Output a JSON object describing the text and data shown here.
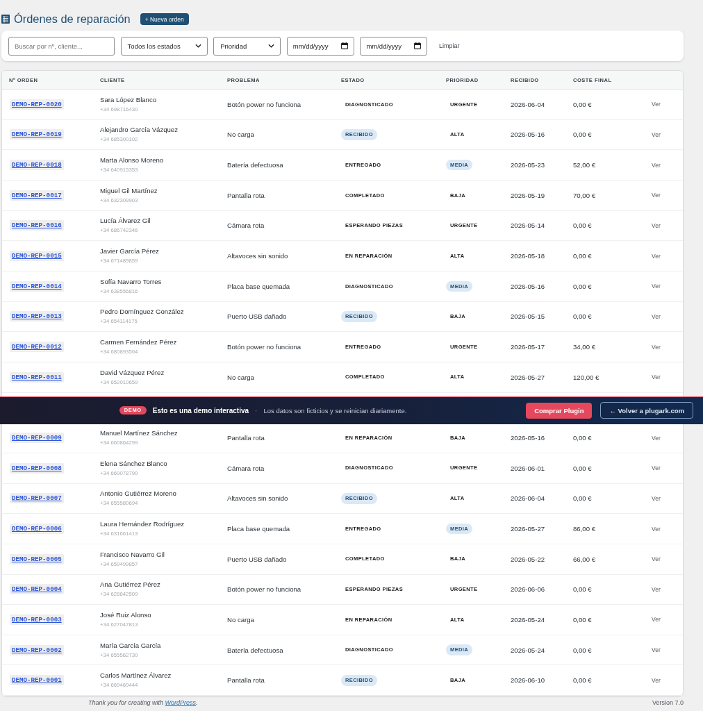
{
  "header": {
    "title": "Órdenes de reparación",
    "new_button": "+ Nueva orden"
  },
  "filters": {
    "search": {
      "placeholder": "Buscar por nº, cliente..."
    },
    "status_select": {
      "value": "Todos los estados"
    },
    "priority_select": {
      "value": "Prioridad"
    },
    "date_from": {
      "placeholder": "mm/dd/yyyy"
    },
    "date_to": {
      "placeholder": "mm/dd/yyyy"
    },
    "clear_button": "Limpiar"
  },
  "table": {
    "columns": [
      "Nº ORDEN",
      "CLIENTE",
      "PROBLEMA",
      "ESTADO",
      "PRIORIDAD",
      "RECIBIDO",
      "COSTE FINAL"
    ],
    "rows_above_banner": [
      {
        "order": "DEMO-REP-0020",
        "client": "Sara López Blanco",
        "phone": "+34 698716430",
        "problem": "Botón power no funciona",
        "status": {
          "label": "DIAGNOSTICADO",
          "kind": "plain"
        },
        "priority": {
          "label": "URGENTE",
          "kind": "plain"
        },
        "received": "2026-06-04",
        "cost": "0,00 €",
        "action": "Ver"
      },
      {
        "order": "DEMO-REP-0019",
        "client": "Alejandro García Vázquez",
        "phone": "+34 685300102",
        "problem": "No carga",
        "status": {
          "label": "RECIBIDO",
          "kind": "pill"
        },
        "priority": {
          "label": "ALTA",
          "kind": "plain"
        },
        "received": "2026-05-16",
        "cost": "0,00 €",
        "action": "Ver"
      },
      {
        "order": "DEMO-REP-0018",
        "client": "Marta Alonso Moreno",
        "phone": "+34 640915353",
        "problem": "Batería defectuosa",
        "status": {
          "label": "ENTREGADO",
          "kind": "plain"
        },
        "priority": {
          "label": "MEDIA",
          "kind": "pill"
        },
        "received": "2026-05-23",
        "cost": "52,00 €",
        "action": "Ver"
      },
      {
        "order": "DEMO-REP-0017",
        "client": "Miguel Gil Martínez",
        "phone": "+34 632309903",
        "problem": "Pantalla rota",
        "status": {
          "label": "COMPLETADO",
          "kind": "plain"
        },
        "priority": {
          "label": "BAJA",
          "kind": "plain"
        },
        "received": "2026-05-19",
        "cost": "70,00 €",
        "action": "Ver"
      },
      {
        "order": "DEMO-REP-0016",
        "client": "Lucía Álvarez Gil",
        "phone": "+34 686742346",
        "problem": "Cámara rota",
        "status": {
          "label": "ESPERANDO PIEZAS",
          "kind": "plain"
        },
        "priority": {
          "label": "URGENTE",
          "kind": "plain"
        },
        "received": "2026-05-14",
        "cost": "0,00 €",
        "action": "Ver"
      },
      {
        "order": "DEMO-REP-0015",
        "client": "Javier García Pérez",
        "phone": "+34 671489859",
        "problem": "Altavoces sin sonido",
        "status": {
          "label": "EN REPARACIÓN",
          "kind": "plain"
        },
        "priority": {
          "label": "ALTA",
          "kind": "plain"
        },
        "received": "2026-05-18",
        "cost": "0,00 €",
        "action": "Ver"
      },
      {
        "order": "DEMO-REP-0014",
        "client": "Sofía Navarro Torres",
        "phone": "+34 638556816",
        "problem": "Placa base quemada",
        "status": {
          "label": "DIAGNOSTICADO",
          "kind": "plain"
        },
        "priority": {
          "label": "MEDIA",
          "kind": "pill"
        },
        "received": "2026-05-16",
        "cost": "0,00 €",
        "action": "Ver"
      },
      {
        "order": "DEMO-REP-0013",
        "client": "Pedro Domínguez González",
        "phone": "+34 654114175",
        "problem": "Puerto USB dañado",
        "status": {
          "label": "RECIBIDO",
          "kind": "pill"
        },
        "priority": {
          "label": "BAJA",
          "kind": "plain"
        },
        "received": "2026-05-15",
        "cost": "0,00 €",
        "action": "Ver"
      },
      {
        "order": "DEMO-REP-0012",
        "client": "Carmen Fernández Pérez",
        "phone": "+34 680893504",
        "problem": "Botón power no funciona",
        "status": {
          "label": "ENTREGADO",
          "kind": "plain"
        },
        "priority": {
          "label": "URGENTE",
          "kind": "plain"
        },
        "received": "2026-05-17",
        "cost": "34,00 €",
        "action": "Ver"
      },
      {
        "order": "DEMO-REP-0011",
        "client": "David Vázquez Pérez",
        "phone": "+34 652010659",
        "problem": "No carga",
        "status": {
          "label": "COMPLETADO",
          "kind": "plain"
        },
        "priority": {
          "label": "ALTA",
          "kind": "plain"
        },
        "received": "2026-05-27",
        "cost": "120,00 €",
        "action": "Ver"
      }
    ],
    "rows_below_banner": [
      {
        "order": "DEMO-REP-0009",
        "client": "Manuel Martínez Sánchez",
        "phone": "+34 660864299",
        "problem": "Pantalla rota",
        "status": {
          "label": "EN REPARACIÓN",
          "kind": "plain"
        },
        "priority": {
          "label": "BAJA",
          "kind": "plain"
        },
        "received": "2026-05-16",
        "cost": "0,00 €",
        "action": "Ver"
      },
      {
        "order": "DEMO-REP-0008",
        "client": "Elena Sánchez Blanco",
        "phone": "+34 669078790",
        "problem": "Cámara rota",
        "status": {
          "label": "DIAGNOSTICADO",
          "kind": "plain"
        },
        "priority": {
          "label": "URGENTE",
          "kind": "plain"
        },
        "received": "2026-06-01",
        "cost": "0,00 €",
        "action": "Ver"
      },
      {
        "order": "DEMO-REP-0007",
        "client": "Antonio Gutiérrez Moreno",
        "phone": "+34 655580694",
        "problem": "Altavoces sin sonido",
        "status": {
          "label": "RECIBIDO",
          "kind": "pill"
        },
        "priority": {
          "label": "ALTA",
          "kind": "plain"
        },
        "received": "2026-06-04",
        "cost": "0,00 €",
        "action": "Ver"
      },
      {
        "order": "DEMO-REP-0006",
        "client": "Laura Hernández Rodríguez",
        "phone": "+34 631661413",
        "problem": "Placa base quemada",
        "status": {
          "label": "ENTREGADO",
          "kind": "plain"
        },
        "priority": {
          "label": "MEDIA",
          "kind": "pill"
        },
        "received": "2026-05-27",
        "cost": "86,00 €",
        "action": "Ver"
      },
      {
        "order": "DEMO-REP-0005",
        "client": "Francisco Navarro Gil",
        "phone": "+34 659499857",
        "problem": "Puerto USB dañado",
        "status": {
          "label": "COMPLETADO",
          "kind": "plain"
        },
        "priority": {
          "label": "BAJA",
          "kind": "plain"
        },
        "received": "2026-05-22",
        "cost": "66,00 €",
        "action": "Ver"
      },
      {
        "order": "DEMO-REP-0004",
        "client": "Ana Gutiérrez Pérez",
        "phone": "+34 628842509",
        "problem": "Botón power no funciona",
        "status": {
          "label": "ESPERANDO PIEZAS",
          "kind": "plain"
        },
        "priority": {
          "label": "URGENTE",
          "kind": "plain"
        },
        "received": "2026-06-06",
        "cost": "0,00 €",
        "action": "Ver"
      },
      {
        "order": "DEMO-REP-0003",
        "client": "José Ruiz Alonso",
        "phone": "+34 627047813",
        "problem": "No carga",
        "status": {
          "label": "EN REPARACIÓN",
          "kind": "plain"
        },
        "priority": {
          "label": "ALTA",
          "kind": "plain"
        },
        "received": "2026-05-24",
        "cost": "0,00 €",
        "action": "Ver"
      },
      {
        "order": "DEMO-REP-0002",
        "client": "María García García",
        "phone": "+34 655562730",
        "problem": "Batería defectuosa",
        "status": {
          "label": "DIAGNOSTICADO",
          "kind": "plain"
        },
        "priority": {
          "label": "MEDIA",
          "kind": "pill"
        },
        "received": "2026-05-24",
        "cost": "0,00 €",
        "action": "Ver"
      },
      {
        "order": "DEMO-REP-0001",
        "client": "Carlos Martínez Álvarez",
        "phone": "+34 669469444",
        "problem": "Pantalla rota",
        "status": {
          "label": "RECIBIDO",
          "kind": "pill"
        },
        "priority": {
          "label": "BAJA",
          "kind": "plain"
        },
        "received": "2026-06-10",
        "cost": "0,00 €",
        "action": "Ver"
      }
    ]
  },
  "demo_banner": {
    "badge": "DEMO",
    "title": "Esto es una demo interactiva",
    "separator": "·",
    "message": "Los datos son ficticios y se reinician diariamente.",
    "buy_button": "Comprar Plugin",
    "back_button": "← Volver a plugark.com"
  },
  "footer": {
    "credit_before": "Thank you for creating with ",
    "credit_link": "WordPress",
    "credit_after": ".",
    "version": "Version 7.0"
  }
}
